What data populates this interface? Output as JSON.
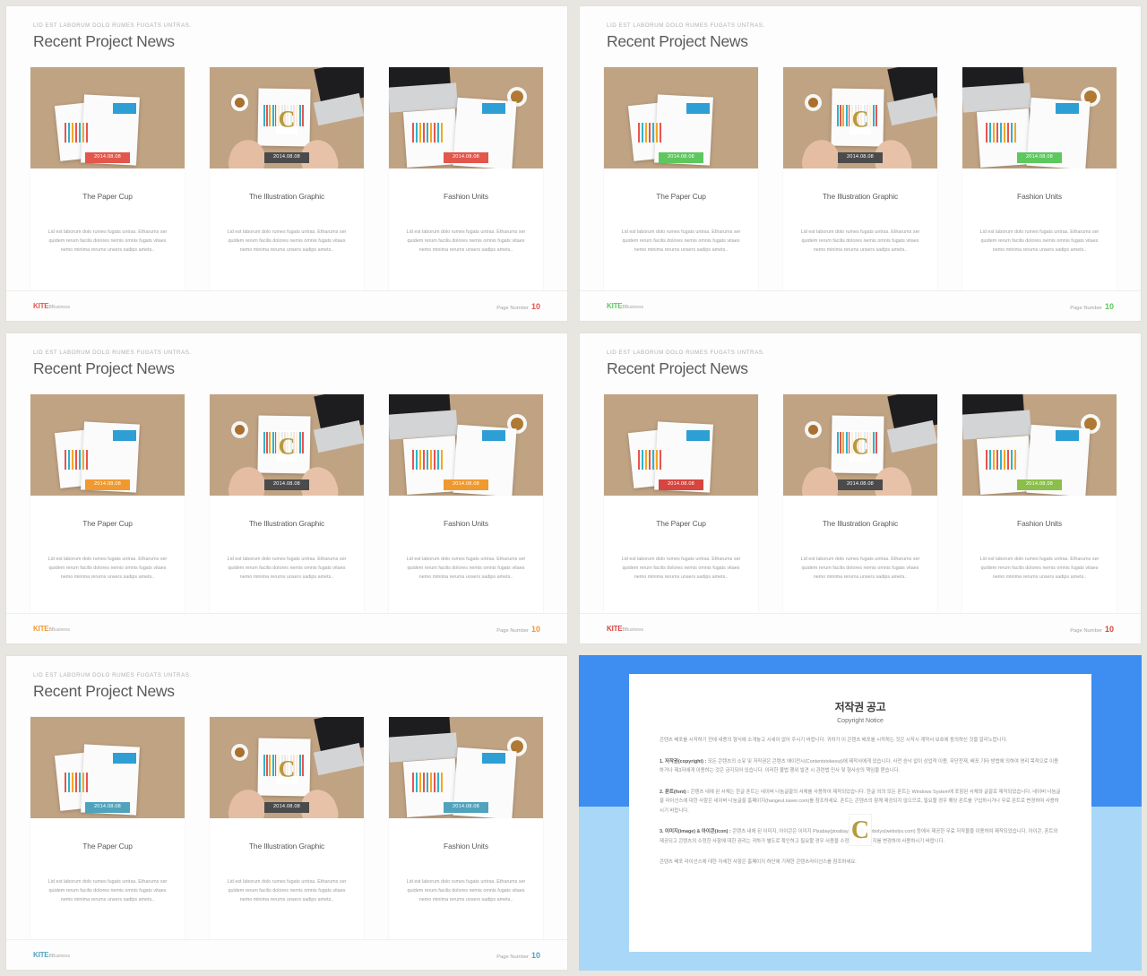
{
  "slides": [
    {
      "kicker": "LID EST LABORUM  DOLO RUMES FUGATS  UNTRAS.",
      "title": "Recent Project News",
      "accent": "#e2564c",
      "brand_name": "KITE",
      "brand_suffix": "BBusiness",
      "page_label": "Page Number",
      "page_number": "10",
      "cards": [
        {
          "title": "The Paper Cup",
          "body": "Lid est laborum dolo rumes fugats untras. Etharums ser quidem rerum facilis dolores nemis omnis fugats vitaes nemo minima rerums unsers sadips amets..",
          "date": "2014.08.08",
          "badge_color": "#e2564c",
          "watermark": "C",
          "has_watermark": false
        },
        {
          "title": "The Illustration Graphic",
          "body": "Lid est laborum dolo rumes fugats untras. Etharums ser quidem rerum facilis dolores nemis omnis fugats vitaes nemo minima rerums unsers sadips amets..",
          "date": "2014.08.08",
          "badge_color": "#4b4b4b",
          "watermark": "C",
          "has_watermark": true
        },
        {
          "title": "Fashion Units",
          "body": "Lid est laborum dolo rumes fugats untras. Etharums ser quidem rerum facilis dolores nemis omnis fugats vitaes nemo minima rerums unsers sadips amets..",
          "date": "2014.08.08",
          "badge_color": "#e2564c",
          "watermark": "C",
          "has_watermark": false
        }
      ]
    },
    {
      "kicker": "LID EST LABORUM  DOLO RUMES FUGATS  UNTRAS.",
      "title": "Recent Project News",
      "accent": "#5ec75e",
      "brand_name": "KITE",
      "brand_suffix": "BBusiness",
      "page_label": "Page Number",
      "page_number": "10",
      "cards": [
        {
          "title": "The Paper Cup",
          "body": "Lid est laborum dolo rumes fugats untras. Etharums ser quidem rerum facilis dolores nemis omnis fugats vitaes nemo minima rerums unsers sadips amets..",
          "date": "2014.08.08",
          "badge_color": "#5ec75e",
          "watermark": "C",
          "has_watermark": false
        },
        {
          "title": "The Illustration Graphic",
          "body": "Lid est laborum dolo rumes fugats untras. Etharums ser quidem rerum facilis dolores nemis omnis fugats vitaes nemo minima rerums unsers sadips amets..",
          "date": "2014.08.08",
          "badge_color": "#4b4b4b",
          "watermark": "C",
          "has_watermark": true
        },
        {
          "title": "Fashion Units",
          "body": "Lid est laborum dolo rumes fugats untras. Etharums ser quidem rerum facilis dolores nemis omnis fugats vitaes nemo minima rerums unsers sadips amets..",
          "date": "2014.08.08",
          "badge_color": "#5ec75e",
          "watermark": "C",
          "has_watermark": false
        }
      ]
    },
    {
      "kicker": "LID EST LABORUM  DOLO RUMES FUGATS  UNTRAS.",
      "title": "Recent Project News",
      "accent": "#f0992f",
      "brand_name": "KITE",
      "brand_suffix": "BBusiness",
      "page_label": "Page Number",
      "page_number": "10",
      "cards": [
        {
          "title": "The Paper Cup",
          "body": "Lid est laborum dolo rumes fugats untras. Etharums ser quidem rerum facilis dolores nemis omnis fugats vitaes nemo minima rerums unsers sadips amets..",
          "date": "2014.08.08",
          "badge_color": "#f0992f",
          "watermark": "C",
          "has_watermark": false
        },
        {
          "title": "The Illustration Graphic",
          "body": "Lid est laborum dolo rumes fugats untras. Etharums ser quidem rerum facilis dolores nemis omnis fugats vitaes nemo minima rerums unsers sadips amets..",
          "date": "2014.08.08",
          "badge_color": "#4b4b4b",
          "watermark": "C",
          "has_watermark": true
        },
        {
          "title": "Fashion Units",
          "body": "Lid est laborum dolo rumes fugats untras. Etharums ser quidem rerum facilis dolores nemis omnis fugats vitaes nemo minima rerums unsers sadips amets..",
          "date": "2014.08.08",
          "badge_color": "#f0992f",
          "watermark": "C",
          "has_watermark": false
        }
      ]
    },
    {
      "kicker": "LID EST LABORUM  DOLO RUMES FUGATS  UNTRAS.",
      "title": "Recent Project News",
      "accent": "#d6453f",
      "brand_name": "KITE",
      "brand_suffix": "BBusiness",
      "page_label": "Page Number",
      "page_number": "10",
      "cards": [
        {
          "title": "The Paper Cup",
          "body": "Lid est laborum dolo rumes fugats untras. Etharums ser quidem rerum facilis dolores nemis omnis fugats vitaes nemo minima rerums unsers sadips amets..",
          "date": "2014.08.08",
          "badge_color": "#d6453f",
          "watermark": "C",
          "has_watermark": false
        },
        {
          "title": "The Illustration Graphic",
          "body": "Lid est laborum dolo rumes fugats untras. Etharums ser quidem rerum facilis dolores nemis omnis fugats vitaes nemo minima rerums unsers sadips amets..",
          "date": "2014.08.08",
          "badge_color": "#4b4b4b",
          "watermark": "C",
          "has_watermark": true
        },
        {
          "title": "Fashion Units",
          "body": "Lid est laborum dolo rumes fugats untras. Etharums ser quidem rerum facilis dolores nemis omnis fugats vitaes nemo minima rerums unsers sadips amets..",
          "date": "2014.08.08",
          "badge_color": "#8bbf4a",
          "watermark": "C",
          "has_watermark": false
        }
      ]
    },
    {
      "kicker": "LID EST LABORUM  DOLO RUMES FUGATS  UNTRAS.",
      "title": "Recent Project News",
      "accent": "#4fa3bd",
      "brand_name": "KITE",
      "brand_suffix": "BBusiness",
      "page_label": "Page Number",
      "page_number": "10",
      "cards": [
        {
          "title": "The Paper Cup",
          "body": "Lid est laborum dolo rumes fugats untras. Etharums ser quidem rerum facilis dolores nemis omnis fugats vitaes nemo minima rerums unsers sadips amets..",
          "date": "2014.08.08",
          "badge_color": "#4fa3bd",
          "watermark": "C",
          "has_watermark": false
        },
        {
          "title": "The Illustration Graphic",
          "body": "Lid est laborum dolo rumes fugats untras. Etharums ser quidem rerum facilis dolores nemis omnis fugats vitaes nemo minima rerums unsers sadips amets..",
          "date": "2014.08.08",
          "badge_color": "#4b4b4b",
          "watermark": "C",
          "has_watermark": true
        },
        {
          "title": "Fashion Units",
          "body": "Lid est laborum dolo rumes fugats untras. Etharums ser quidem rerum facilis dolores nemis omnis fugats vitaes nemo minima rerums unsers sadips amets..",
          "date": "2014.08.08",
          "badge_color": "#4fa3bd",
          "watermark": "C",
          "has_watermark": false
        }
      ]
    }
  ],
  "copyright": {
    "heading_ko": "저작권 공고",
    "heading_en": "Copyright Notice",
    "intro": "콘텐츠 배포를 시작하기 전에 내용의 형식에 소개놓고 시세이 없어 주시기 바랍니다. 귀하가 이 콘텐츠 배포를 시작하는 것은 시작시 계약서 보호에 동의하신 것을 알리노랍니다.",
    "sections": [
      {
        "label": "1. 저작권(copyright) :",
        "text": " 모든 콘텐츠의 소유 및 저작권은 콘텐츠 에이전시(Contentstokeout)에 제작사에게 있습니다. 사전 승낙 없이 상업적 이용, 무단전재, 배포 기타 방법에 의하여 영리 목적으로 이용하거나 제3자에게 이용하는 것은 금지되어 있습니다. 이러한 불법 행위 발견 시 관련법 민사 및 형사상의 책임을 묻습니다."
      },
      {
        "label": "2. 폰트(font) :",
        "text": " 콘텐츠 내에 된 서체는 한글 폰트는 네이버 나눔글꼴의 서체를 사용하여 제작되었습니다. 한글 외의 모든 폰트는 Windows System에 포함된 서체와 글꼴로 제작되었습니다. 네이버 나눔글꼴 라이선스에 대한 사항은 네이버 나눔글꼴 홈페이지(hangeul.naver.com)를 참조하세요. 폰트는 콘텐츠의 함께 제공되지 않으므로, 필요할 경우 해당 폰트를 구입하시거나 무료 폰트로 변경하여 사용하시기 바랍니다."
      },
      {
        "label": "3. 이미지(image) & 아이콘(icon) :",
        "text": " 콘텐츠 내에 된 이미지, 아이콘은 이미지 Pixabay(pixabay.com)과 Webolys(webolys.com) 등에서 제공한 무료 저작물을 이용하여 제작되었습니다. 아이콘, 폰트와 제공되고 콘텐츠의 수정한 사항에 대한 권리는 귀하가 별도로 확인하고 필요할 경우 사용을 수정하셔서 이미지를 변경하여 사용하시기 바랍니다."
      }
    ],
    "footer_note": "콘텐츠 배포 라이선스에 대한 자세한 사항은 홈페이지 하단에 기재한 콘텐츠라이선스를 참조하세요.",
    "seal": "C"
  }
}
